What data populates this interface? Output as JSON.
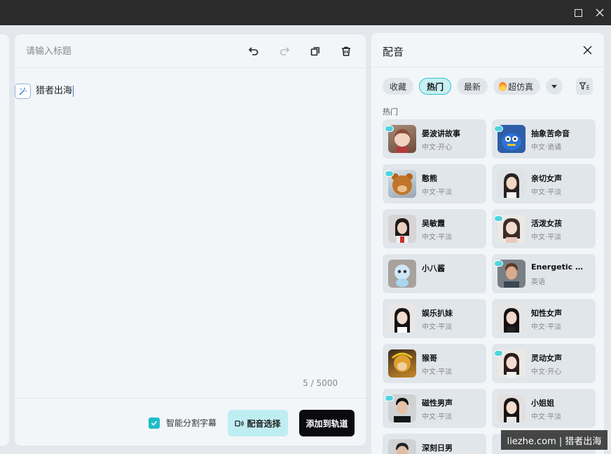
{
  "window": {
    "maximize_icon": "maximize-icon",
    "close_icon": "close-icon"
  },
  "editor": {
    "title_placeholder": "请输入标题",
    "content": "猎者出海",
    "char_count": "5 / 5000",
    "smart_subtitle_label": "智能分割字幕",
    "smart_subtitle_checked": true,
    "voice_select_label": "配音选择",
    "add_to_track_label": "添加到轨道"
  },
  "voice_panel": {
    "title": "配音",
    "filters": [
      "收藏",
      "热门",
      "最新",
      "超仿真"
    ],
    "active_filter": "热门",
    "section_label": "热门",
    "voices": [
      {
        "name": "晏波讲故事",
        "desc": "中文·开心"
      },
      {
        "name": "抽象苦命音",
        "desc": "中文·诡谲"
      },
      {
        "name": "憨熊",
        "desc": "中文·平淡"
      },
      {
        "name": "亲切女声",
        "desc": "中文·平淡"
      },
      {
        "name": "吴敏霞",
        "desc": "中文·平淡"
      },
      {
        "name": "活泼女孩",
        "desc": "中文·平淡"
      },
      {
        "name": "小八酱",
        "desc": ""
      },
      {
        "name": "Energetic M...",
        "desc": "英语"
      },
      {
        "name": "娱乐扒妹",
        "desc": "中文·平淡"
      },
      {
        "name": "知性女声",
        "desc": "中文·平淡"
      },
      {
        "name": "猴哥",
        "desc": "中文·平淡"
      },
      {
        "name": "灵动女声",
        "desc": "中文·开心"
      },
      {
        "name": "磁性男声",
        "desc": "中文·平淡"
      },
      {
        "name": "小姐姐",
        "desc": "中文·平淡"
      },
      {
        "name": "深刻日男",
        "desc": ""
      },
      {
        "name": "",
        "desc": ""
      }
    ]
  },
  "watermark": "liezhe.com | 猎者出海",
  "colors": {
    "accent": "#20bcc8",
    "dark_button": "#0b0b0f"
  }
}
